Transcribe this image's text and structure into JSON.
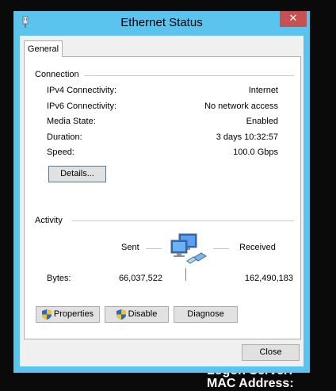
{
  "window": {
    "title": "Ethernet Status"
  },
  "tabs": [
    {
      "label": "General"
    }
  ],
  "connection": {
    "heading": "Connection",
    "rows": [
      {
        "label": "IPv4 Connectivity:",
        "value": "Internet"
      },
      {
        "label": "IPv6 Connectivity:",
        "value": "No network access"
      },
      {
        "label": "Media State:",
        "value": "Enabled"
      },
      {
        "label": "Duration:",
        "value": "3 days 10:32:57"
      },
      {
        "label": "Speed:",
        "value": "100.0 Gbps"
      }
    ],
    "details_button": "Details..."
  },
  "activity": {
    "heading": "Activity",
    "sent_label": "Sent",
    "received_label": "Received",
    "bytes_label": "Bytes:",
    "bytes_sent": "66,037,522",
    "bytes_received": "162,490,183"
  },
  "buttons": {
    "properties": "Properties",
    "disable": "Disable",
    "diagnose": "Diagnose",
    "close": "Close"
  },
  "background_text": {
    "line1": "Logon Server:",
    "line2": "MAC Address:"
  },
  "icons": {
    "title": "network-adapter-icon",
    "activity": "network-computers-icon",
    "shield": "uac-shield-icon"
  },
  "colors": {
    "window_frame": "#5ac4ee",
    "close_button": "#c75050",
    "panel": "#ffffff",
    "client": "#f0f0f0"
  }
}
